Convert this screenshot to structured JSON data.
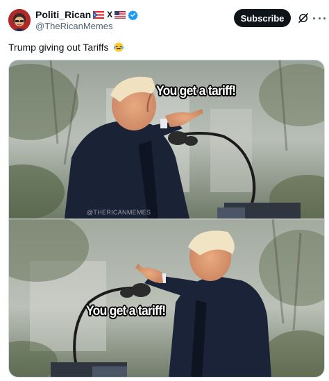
{
  "author": {
    "display_name": "Politi_Rican",
    "name_suffix_mark": "X",
    "handle": "@TheRicanMemes",
    "verified": true,
    "avatar_icon": "avatar-character-icon"
  },
  "actions": {
    "subscribe_label": "Subscribe",
    "grok_icon": "grok-icon",
    "more_icon": "more-icon"
  },
  "post": {
    "text": "Trump giving out Tariffs",
    "emoji": "laughing-tears-emoji"
  },
  "media": {
    "top_caption": "You get a tariff!",
    "bottom_caption": "You get a tariff!",
    "watermark": "@THERICANMEMES"
  },
  "colors": {
    "text_primary": "#0f1419",
    "text_secondary": "#536471",
    "verified_blue": "#1d9bf0",
    "button_bg": "#0f1419"
  }
}
